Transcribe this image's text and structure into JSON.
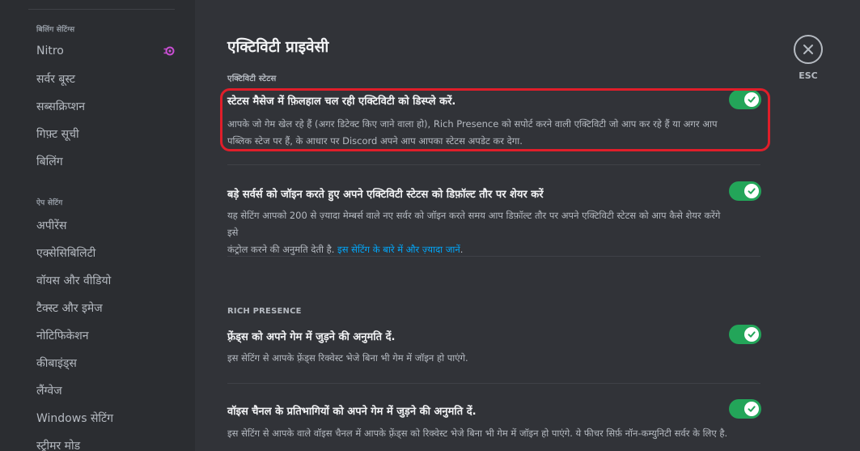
{
  "sidebar": {
    "billing_header": "बिलिंग सेटिंग्स",
    "billing_items": [
      "Nitro",
      "सर्वर बूस्ट",
      "सब्सक्रिप्शन",
      "गिफ़्ट सूची",
      "बिलिंग"
    ],
    "app_header": "ऐप सेटिंग",
    "app_items": [
      "अपीरेंस",
      "एक्सेसिबिलिटी",
      "वॉयस और वीडियो",
      "टैक्स्ट और इमेज",
      "नोटिफिकेशन",
      "कीबाइंड्स",
      "लैंग्वेज",
      "Windows सेटिंग",
      "स्ट्रीमर मोड"
    ]
  },
  "page": {
    "title": "एक्टिविटी प्राइवेसी",
    "activity_status_header": "एक्टिविटी स्टेटस",
    "rich_presence_header": "RICH PRESENCE"
  },
  "settings": [
    {
      "title": "स्टेटस मैसेज में फ़िलहाल चल रही एक्टिविटी को डिस्प्ले करें.",
      "desc_line1": "आपके जो गेम खेल रहे हैं (अगर डिटेक्ट किए जाने वाला हो), Rich Presence को सपोर्ट करने वाली एक्टिविटी जो आप कर रहे हैं या अगर आप",
      "desc_line2": "पब्लिक स्टेज पर हैं, के आधार पर Discord अपने आप आपका स्टेटस अपडेट कर देगा.",
      "enabled": true
    },
    {
      "title": "बड़े सर्वर्स को जॉइन करते हुए अपने एक्टिविटी स्टेटस को डिफ़ॉल्ट तौर पर शेयर करें",
      "desc_line1": "यह सेटिंग आपको 200 से ज़्यादा मेम्बर्स वाले नए सर्वर को जॉइन करते समय आप डिफ़ॉल्ट तौर पर अपने एक्टिविटी स्टेटस को आप कैसे शेयर करेंगे इसे",
      "desc_line2": "कंट्रोल करने की अनुमति देती है.",
      "link": "इस सेटिंग के बारे में और ज़्यादा जानें",
      "desc_end": ".",
      "enabled": true
    },
    {
      "title": "फ़्रेंड्स को अपने गेम में जुड़ने की अनुमति दें.",
      "desc_line1": "इस सेटिंग से आपके फ़्रेंड्स रिक्वेस्ट भेजे बिना भी गेम में जॉइन हो पाएंगे.",
      "enabled": true
    },
    {
      "title": "वॉइस चैनल के प्रतिभागियों को अपने गेम में जुड़ने की अनुमति दें.",
      "desc_line1": "इस सेटिंग से आपके वाले वॉइस चैनल में आपके फ़्रेंड्स को रिक्वेस्ट भेजे बिना भी गेम में जॉइन हो पाएंगे. ये फीचर सिर्फ़ नॉन-कम्युनिटी सर्वर के लिए है.",
      "enabled": true
    }
  ],
  "close": {
    "esc_label": "ESC"
  },
  "colors": {
    "toggle_on": "#23a559",
    "link": "#00a8fc",
    "highlight": "#e01e2a",
    "nitro": "#c94ed3"
  }
}
